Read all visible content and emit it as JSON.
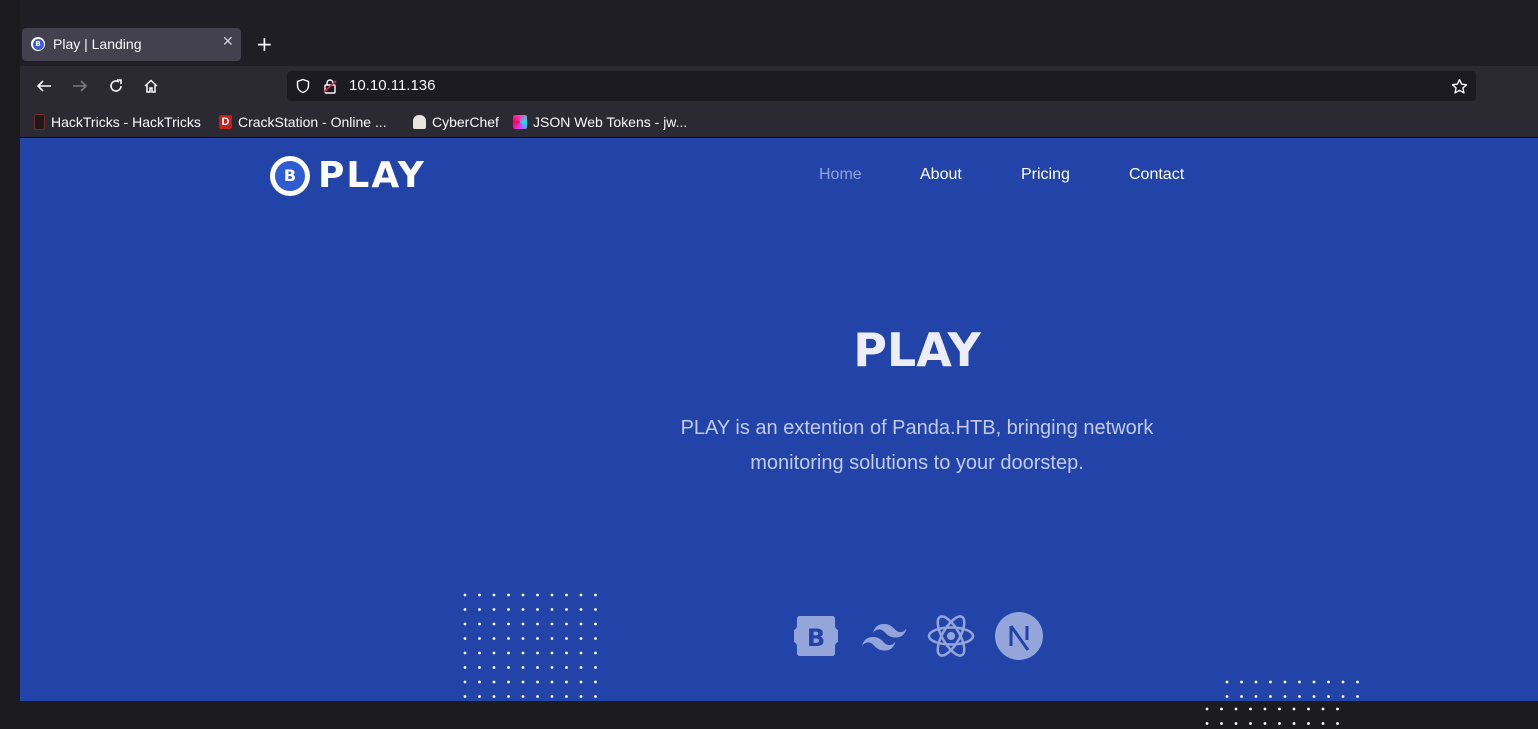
{
  "browser": {
    "tab": {
      "title": "Play | Landing"
    },
    "url": "10.10.11.136",
    "bookmarks": [
      {
        "label": "HackTricks - HackTricks",
        "icon": "hacktricks-icon"
      },
      {
        "label": "CrackStation - Online ...",
        "icon": "crackstation-icon"
      },
      {
        "label": "CyberChef",
        "icon": "cyberchef-icon"
      },
      {
        "label": "JSON Web Tokens - jw...",
        "icon": "jwt-icon"
      }
    ]
  },
  "site": {
    "logo_text": "PLAY",
    "logo_letter": "B",
    "nav": [
      {
        "label": "Home",
        "active": true
      },
      {
        "label": "About",
        "active": false
      },
      {
        "label": "Pricing",
        "active": false
      },
      {
        "label": "Contact",
        "active": false
      }
    ],
    "hero": {
      "title": "PLAY",
      "text": "PLAY is an extention of Panda.HTB, bringing network monitoring solutions to your doorstep."
    },
    "tech_icons": [
      "bootstrap-icon",
      "tailwind-icon",
      "react-icon",
      "nextjs-icon"
    ],
    "colors": {
      "page_bg": "#2243a8",
      "nav_active": "#93a5d9",
      "tech_icon": "#94a5da"
    }
  }
}
